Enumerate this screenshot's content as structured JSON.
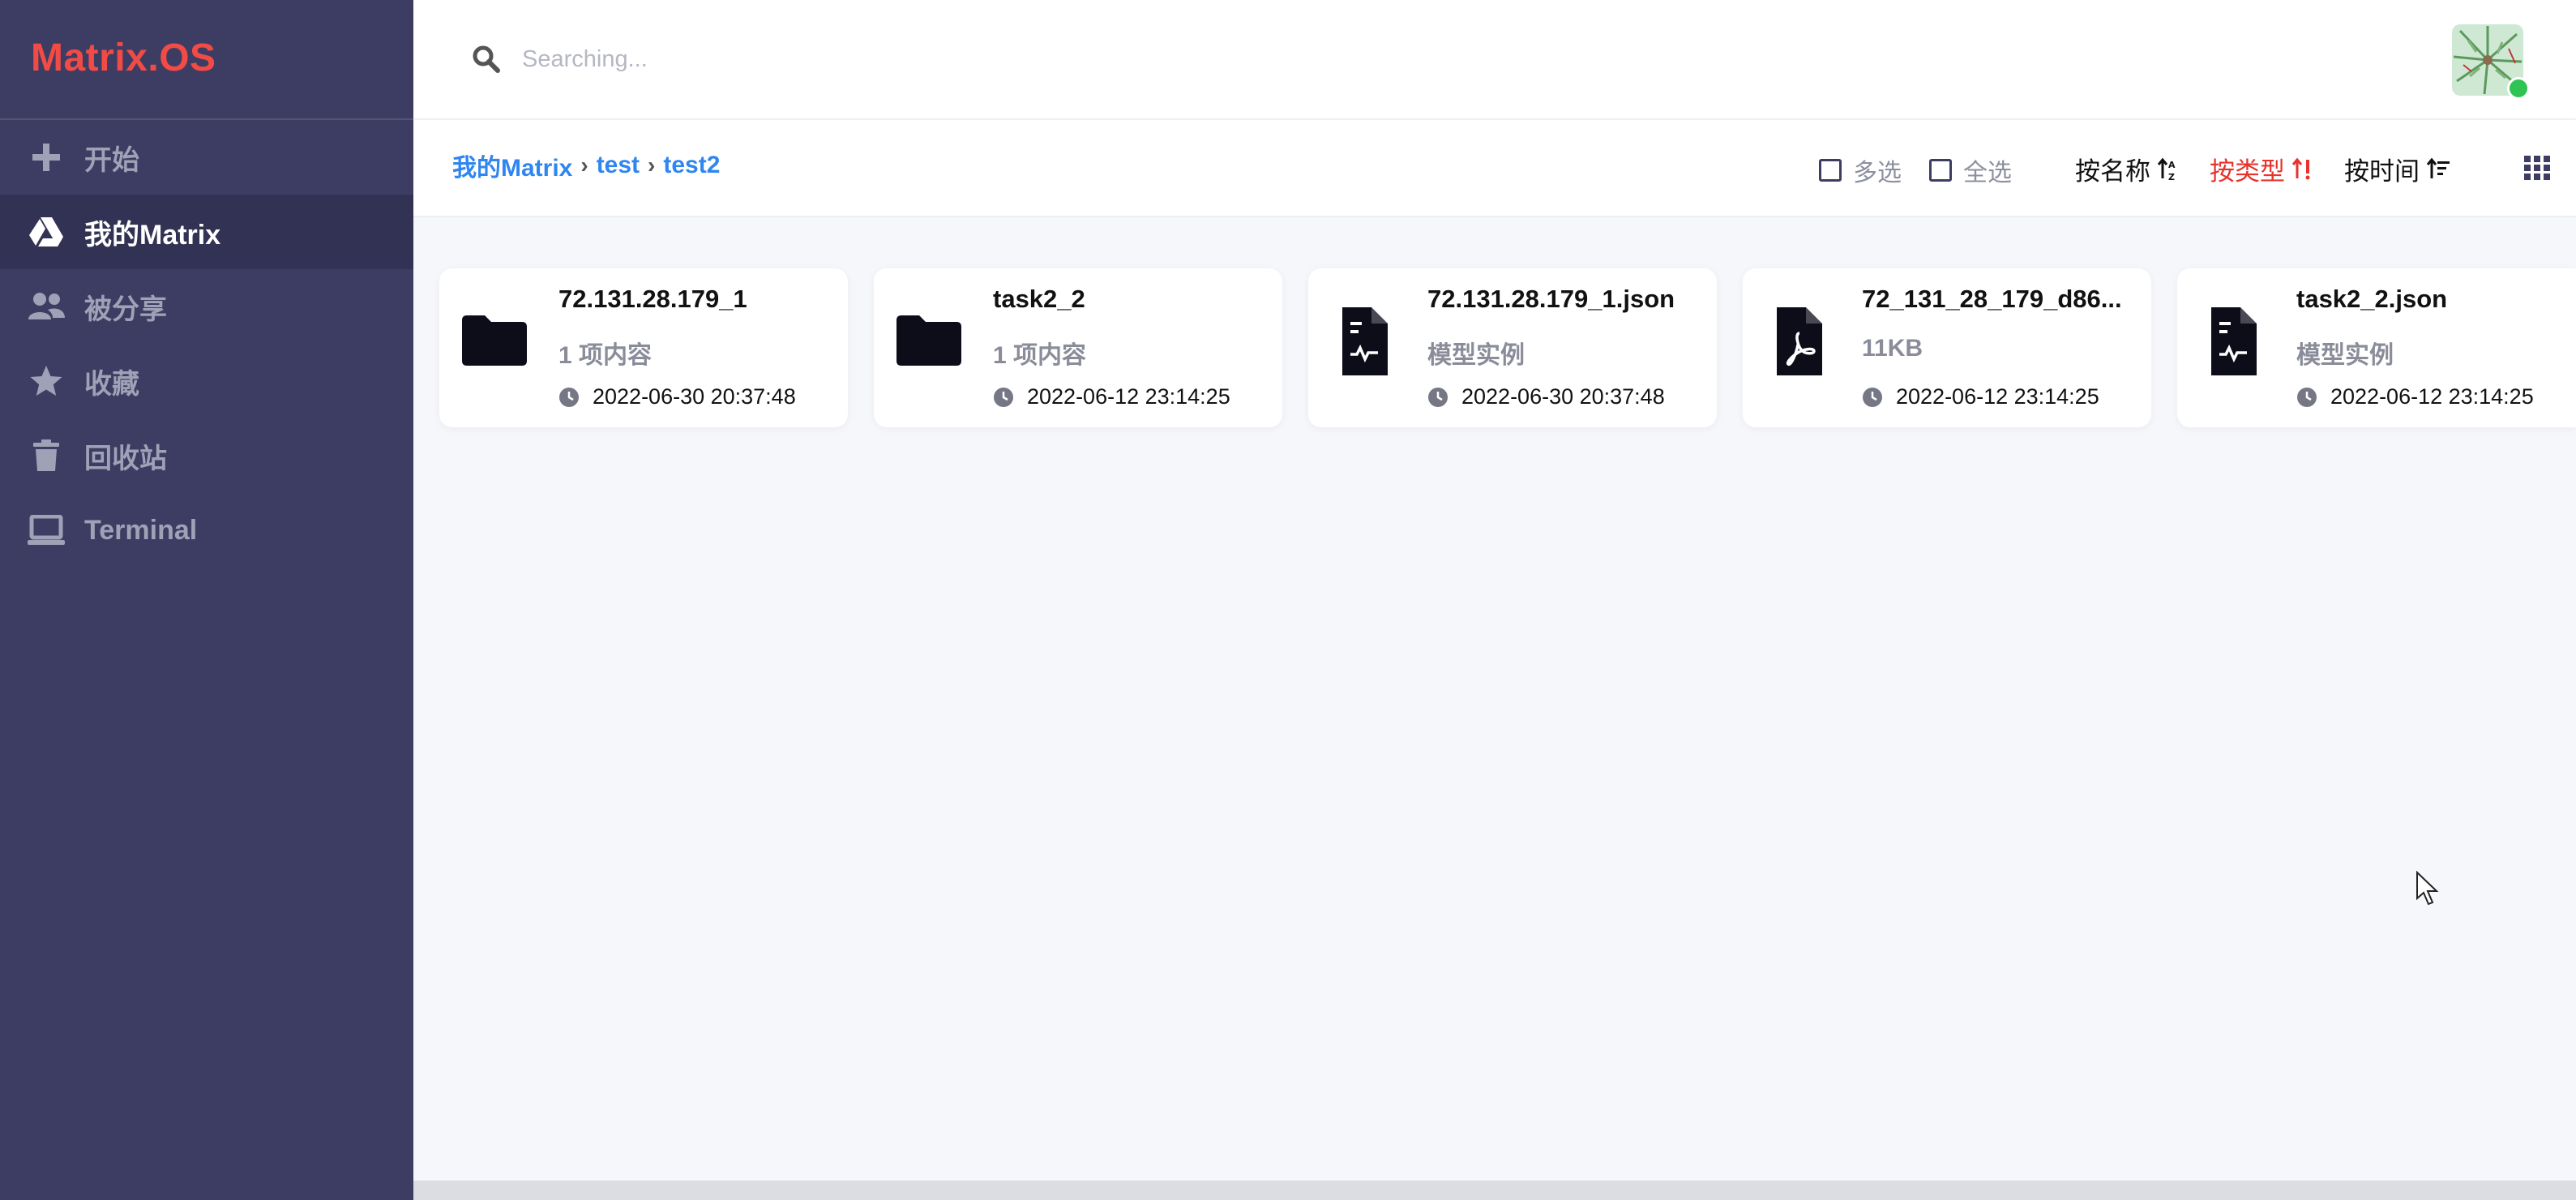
{
  "app": {
    "logo": "Matrix.OS"
  },
  "sidebar": {
    "items": [
      {
        "label": "开始",
        "icon": "plus-icon"
      },
      {
        "label": "我的Matrix",
        "icon": "drive-icon",
        "active": true
      },
      {
        "label": "被分享",
        "icon": "users-icon"
      },
      {
        "label": "收藏",
        "icon": "star-icon"
      },
      {
        "label": "回收站",
        "icon": "trash-icon"
      },
      {
        "label": "Terminal",
        "icon": "laptop-icon"
      }
    ]
  },
  "search": {
    "placeholder": "Searching...",
    "value": ""
  },
  "breadcrumb": [
    "我的Matrix",
    "test",
    "test2"
  ],
  "toolbar": {
    "multi_select": "多选",
    "select_all": "全选",
    "sort_name": "按名称",
    "sort_type": "按类型",
    "sort_time": "按时间",
    "active_sort": "按类型",
    "accent_color": "#e8322b",
    "link_color": "#2f86f0"
  },
  "files": [
    {
      "name": "72.131.28.179_1",
      "meta": "1 项内容",
      "date": "2022-06-30 20:37:48",
      "icon": "folder-icon"
    },
    {
      "name": "task2_2",
      "meta": "1 项内容",
      "date": "2022-06-12 23:14:25",
      "icon": "folder-icon"
    },
    {
      "name": "72.131.28.179_1.json",
      "meta": "模型实例",
      "date": "2022-06-30 20:37:48",
      "icon": "model-file-icon"
    },
    {
      "name": "72_131_28_179_d86...",
      "meta": "11KB",
      "date": "2022-06-12 23:14:25",
      "icon": "pdf-file-icon"
    },
    {
      "name": "task2_2.json",
      "meta": "模型实例",
      "date": "2022-06-12 23:14:25",
      "icon": "model-file-icon"
    }
  ]
}
